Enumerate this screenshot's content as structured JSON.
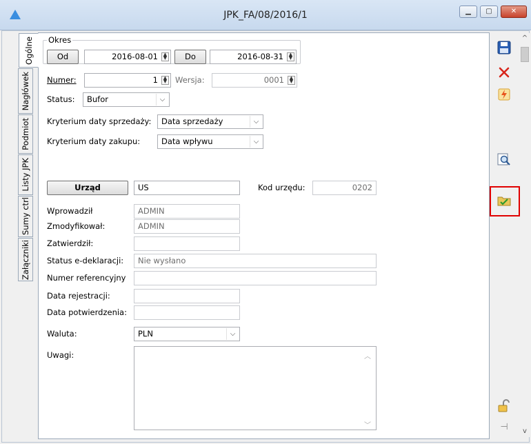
{
  "window": {
    "title": "JPK_FA/08/2016/1"
  },
  "tabs": [
    {
      "label": "Ogólne",
      "active": true
    },
    {
      "label": "Nagłówek"
    },
    {
      "label": "Podmiot"
    },
    {
      "label": "Listy JPK"
    },
    {
      "label": "Sumy ctrl"
    },
    {
      "label": "Załączniki"
    }
  ],
  "okres": {
    "group_label": "Okres",
    "od_label": "Od",
    "od_value": "2016-08-01",
    "do_label": "Do",
    "do_value": "2016-08-31"
  },
  "numer": {
    "label": "Numer:",
    "value": "1"
  },
  "wersja": {
    "label": "Wersja:",
    "value": "0001"
  },
  "status": {
    "label": "Status:",
    "value": "Bufor"
  },
  "kryterium_sprzedazy": {
    "label": "Kryterium daty sprzedaży:",
    "value": "Data sprzedaży"
  },
  "kryterium_zakupu": {
    "label": "Kryterium daty zakupu:",
    "value": "Data wpływu"
  },
  "urzad": {
    "button_label": "Urząd",
    "value": "US",
    "kod_label": "Kod urzędu:",
    "kod_value": "0202"
  },
  "info": {
    "wprowadzil_label": "Wprowadził",
    "wprowadzil_value": "ADMIN",
    "zmodyfikowal_label": "Zmodyfikował:",
    "zmodyfikowal_value": "ADMIN",
    "zatwierdzil_label": "Zatwierdził:",
    "zatwierdzil_value": "",
    "status_edek_label": "Status e-deklaracji:",
    "status_edek_value": "Nie wysłano",
    "numer_ref_label": "Numer referencyjny",
    "numer_ref_value": "",
    "data_rej_label": "Data rejestracji:",
    "data_rej_value": "",
    "data_potw_label": "Data potwierdzenia:",
    "data_potw_value": ""
  },
  "waluta": {
    "label": "Waluta:",
    "value": "PLN"
  },
  "uwagi": {
    "label": "Uwagi:",
    "value": ""
  },
  "colors": {
    "highlight": "#e00000",
    "accent": "#3a8ee0"
  }
}
